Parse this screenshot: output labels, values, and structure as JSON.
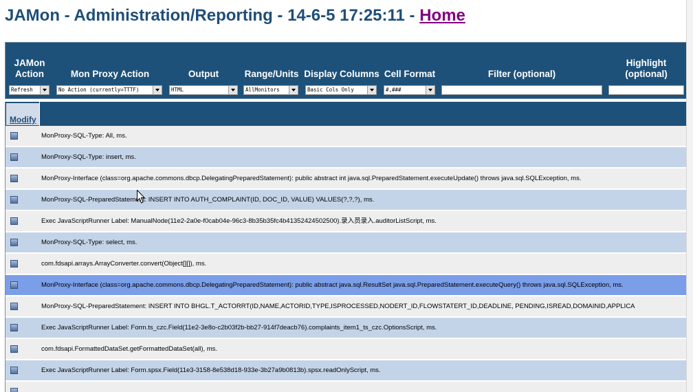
{
  "header": {
    "title": "JAMon - Administration/Reporting - 14-6-5 17:25:11 - ",
    "home_link": "Home"
  },
  "controls": {
    "columns": [
      {
        "label": "JAMon Action",
        "value": "Refresh"
      },
      {
        "label": "Mon Proxy Action",
        "value": "No Action (currently=TTTF)"
      },
      {
        "label": "Output",
        "value": "HTML"
      },
      {
        "label": "Range/Units",
        "value": "AllMonitors"
      },
      {
        "label": "Display Columns",
        "value": "Basic Cols Only"
      },
      {
        "label": "Cell Format",
        "value": "#,###"
      },
      {
        "label": "Filter (optional)",
        "value": ""
      },
      {
        "label": "Highlight (optional)",
        "value": ""
      }
    ]
  },
  "grid": {
    "modify_label": "Modify",
    "rows": [
      "MonProxy-SQL-Type: All, ms.",
      "MonProxy-SQL-Type: insert, ms.",
      "MonProxy-Interface (class=org.apache.commons.dbcp.DelegatingPreparedStatement): public abstract int java.sql.PreparedStatement.executeUpdate() throws java.sql.SQLException, ms.",
      "MonProxy-SQL-PreparedStatement: INSERT INTO AUTH_COMPLAINT(ID, DOC_ID, VALUE) VALUES(?,?,?), ms.",
      "Exec JavaScriptRunner Label: ManualNode(11e2-2a0e-f0cab04e-96c3-8b35b35fc4b41352424502500).录入员录入.auditorListScript, ms.",
      "MonProxy-SQL-Type: select, ms.",
      "com.fdsapi.arrays.ArrayConverter.convert(Object[][]), ms.",
      "MonProxy-Interface (class=org.apache.commons.dbcp.DelegatingPreparedStatement): public abstract java.sql.ResultSet java.sql.PreparedStatement.executeQuery() throws java.sql.SQLException, ms.",
      "MonProxy-SQL-PreparedStatement: INSERT INTO BHGL.T_ACTORRT(ID,NAME,ACTORID,TYPE,ISPROCESSED,NODERT_ID,FLOWSTATERT_ID,DEADLINE, PENDING,ISREAD,DOMAINID,APPLICA",
      "Exec JavaScriptRunner Label: Form.ts_czc.Field(11e2-3e8o-c2b03f2b-bb27-914f7deacb76).complaints_item1_ts_czc.OptionsScript, ms.",
      "com.fdsapi.FormattedDataSet.getFormattedDataSet(all), ms.",
      "Exec JavaScriptRunner Label: Form.spsx.Field(11e3-3158-8e538d18-933e-3b27a9b0813b).spsx.readOnlyScript, ms."
    ]
  },
  "colors": {
    "title": "#1e4e78",
    "header_band": "#1d5179",
    "row_light": "#eeeeee",
    "row_blue": "#c4d4e8",
    "row_highlight": "#7b9ee8"
  }
}
